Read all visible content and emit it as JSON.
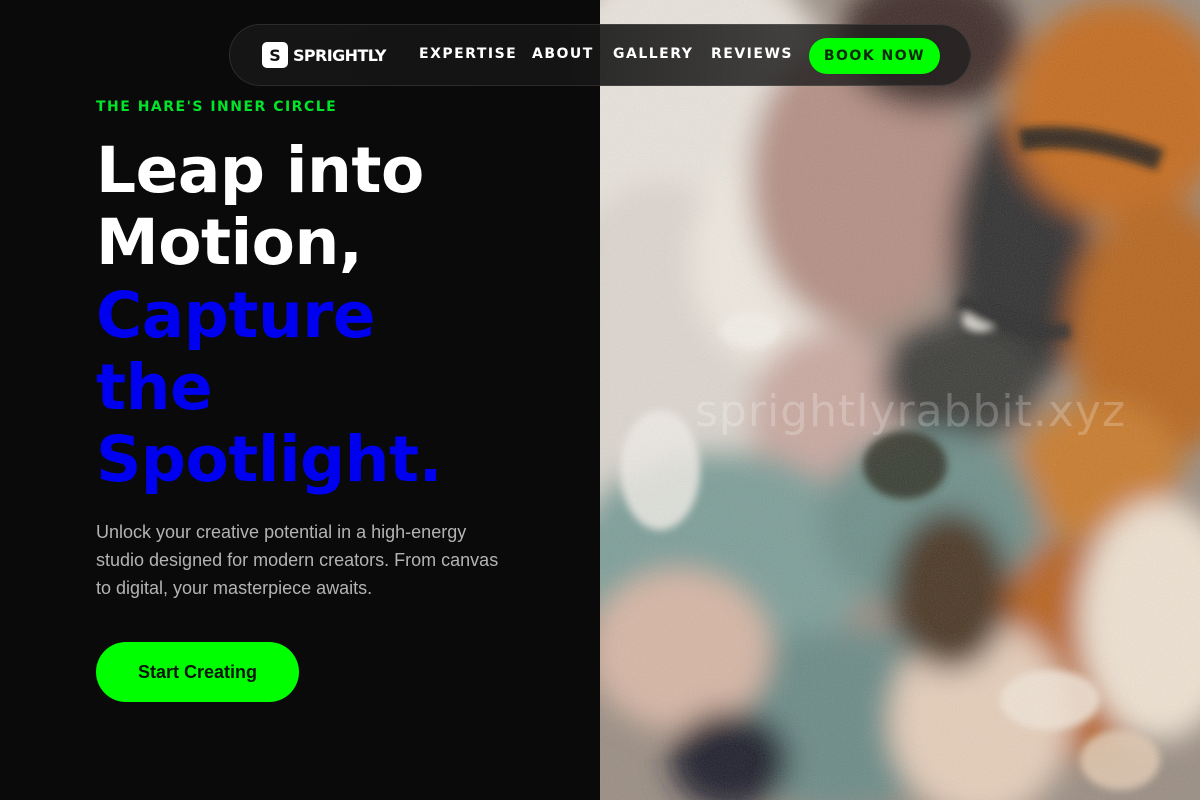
{
  "brand": {
    "logo_letter": "S",
    "name": "SPRIGHTLY"
  },
  "nav": {
    "links": [
      "EXPERTISE",
      "ABOUT",
      "GALLERY",
      "REVIEWS"
    ],
    "cta_label": "BOOK NOW"
  },
  "hero": {
    "eyebrow": "THE HARE'S INNER CIRCLE",
    "title_white": [
      "Leap into",
      "Motion,"
    ],
    "title_blue": [
      "Capture",
      "the",
      "Spotlight."
    ],
    "subtext": "Unlock your creative potential in a high-energy studio designed for modern creators. From canvas to digital, your masterpiece awaits.",
    "cta_label": "Start Creating"
  },
  "image": {
    "watermark": "sprightlyrabbit.xyz"
  },
  "colors": {
    "accent_green": "#00ff00",
    "eyebrow_green": "#00e52a",
    "headline_blue": "#0000f0",
    "background": "#0a0a0a"
  }
}
